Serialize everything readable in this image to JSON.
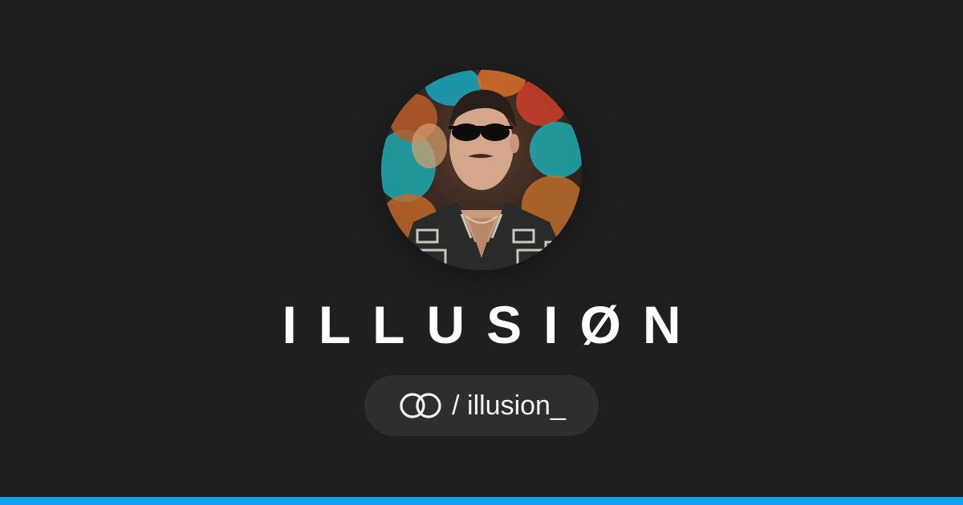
{
  "profile": {
    "name": "ILLUSIØN",
    "handle_text": "/ illusion_",
    "avatar_icon": "profile-photo",
    "brand_icon": "linked-circles-logo-icon"
  },
  "colors": {
    "background": "#1f1f1f",
    "pill_background": "#2e2e2e",
    "text": "#ffffff",
    "accent": "#0aa3f0"
  }
}
